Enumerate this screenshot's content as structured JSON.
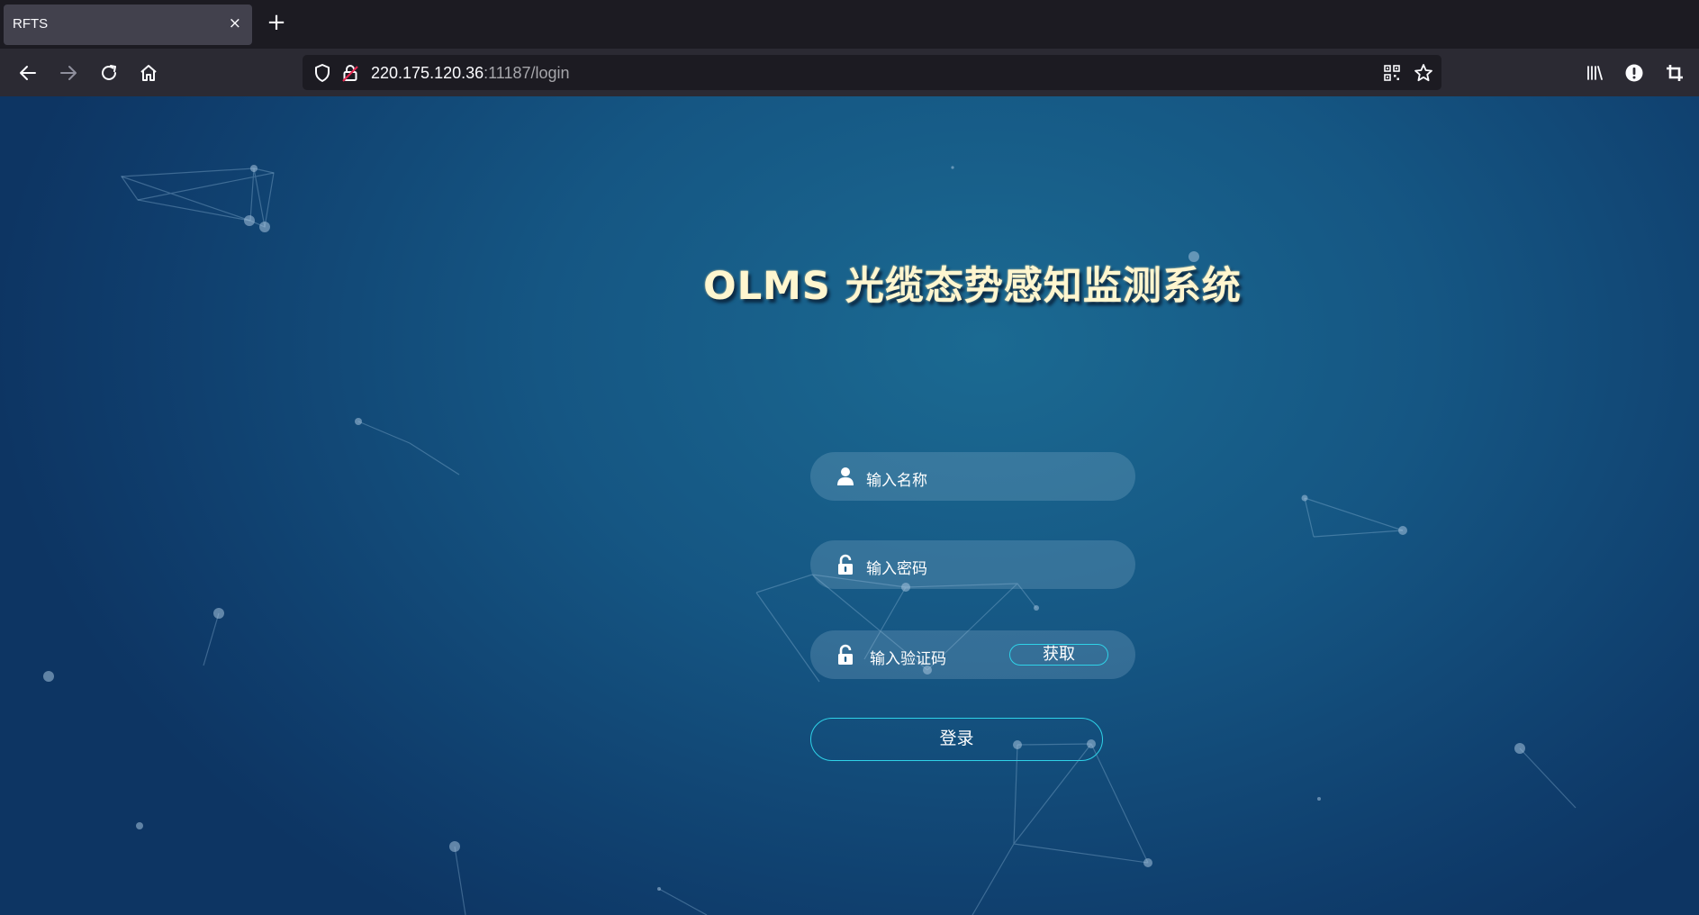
{
  "browser": {
    "tab_title": "RFTS",
    "tab_close": "×",
    "new_tab": "+",
    "url_host": "220.175.120.36",
    "url_rest": ":11187/login"
  },
  "page": {
    "title": "OLMS 光缆态势感知监测系统",
    "username_placeholder": "输入名称",
    "password_placeholder": "输入密码",
    "code_placeholder": "输入验证码",
    "get_code_label": "获取",
    "login_label": "登录"
  },
  "colors": {
    "accent_border": "#2fd2e8",
    "title_text": "#fff6cf",
    "chrome_bg": "#2b2a33"
  }
}
